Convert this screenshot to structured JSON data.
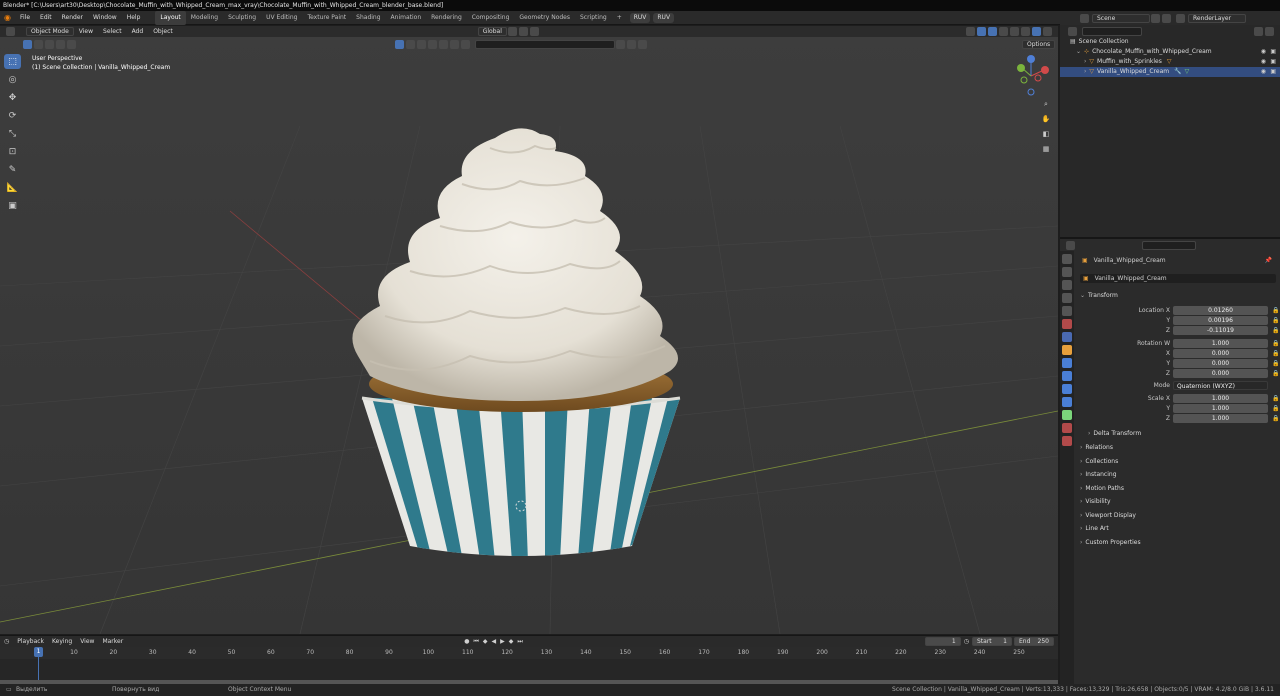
{
  "window": {
    "title": "Blender* [C:\\Users\\art30\\Desktop\\Chocolate_Muffin_with_Whipped_Cream_max_vray\\Chocolate_Muffin_with_Whipped_Cream_blender_base.blend]"
  },
  "menu": [
    "File",
    "Edit",
    "Render",
    "Window",
    "Help"
  ],
  "workspaces": [
    "Layout",
    "Modeling",
    "Sculpting",
    "UV Editing",
    "Texture Paint",
    "Shading",
    "Animation",
    "Rendering",
    "Compositing",
    "Geometry Nodes",
    "Scripting"
  ],
  "workspace_add": "+",
  "topbar_pills": [
    "RUV",
    "RUV"
  ],
  "scene": {
    "label": "Scene",
    "view_layer": "RenderLayer"
  },
  "viewport": {
    "mode": "Object Mode",
    "menus": [
      "View",
      "Select",
      "Add",
      "Object"
    ],
    "transform_orientation": "Global",
    "options_label": "Options",
    "info_line1": "User Perspective",
    "info_line2": "(1) Scene Collection | Vanilla_Whipped_Cream",
    "tools": [
      "cursor-icon",
      "move-icon",
      "rotate-icon",
      "scale-icon",
      "transform-icon",
      "annotate-icon",
      "measure-icon",
      "add-cube-icon"
    ]
  },
  "outliner": {
    "root": "Scene Collection",
    "items": [
      {
        "label": "Chocolate_Muffin_with_Whipped_Cream",
        "depth": 1
      },
      {
        "label": "Muffin_with_Sprinkles",
        "depth": 2
      },
      {
        "label": "Vanilla_Whipped_Cream",
        "depth": 2
      }
    ]
  },
  "properties": {
    "object_name": "Vanilla_Whipped_Cream",
    "data_name": "Vanilla_Whipped_Cream",
    "transform_title": "Transform",
    "location": {
      "label": "Location X",
      "x": "0.01260",
      "y": "0.00196",
      "z": "-0.11019"
    },
    "rotation": {
      "label": "Rotation W",
      "w": "1.000",
      "x": "0.000",
      "y": "0.000",
      "z": "0.000"
    },
    "mode": {
      "label": "Mode",
      "value": "Quaternion (WXYZ)"
    },
    "scale": {
      "label": "Scale X",
      "x": "1.000",
      "y": "1.000",
      "z": "1.000"
    },
    "axis_labels": {
      "y": "Y",
      "z": "Z",
      "x": "X"
    },
    "delta_transform": "Delta Transform",
    "panels": [
      "Relations",
      "Collections",
      "Instancing",
      "Motion Paths",
      "Visibility",
      "Viewport Display",
      "Line Art",
      "Custom Properties"
    ]
  },
  "timeline": {
    "menus": [
      "Playback",
      "Keying",
      "View",
      "Marker"
    ],
    "current_frame": "1",
    "start_label": "Start",
    "start": "1",
    "end_label": "End",
    "end": "250",
    "playhead": "1",
    "ticks": [
      "10",
      "20",
      "30",
      "40",
      "50",
      "60",
      "70",
      "80",
      "90",
      "100",
      "110",
      "120",
      "130",
      "140",
      "150",
      "160",
      "170",
      "180",
      "190",
      "200",
      "210",
      "220",
      "230",
      "240",
      "250"
    ]
  },
  "statusbar": {
    "left1": "Выделить",
    "left2": "Повернуть вид",
    "left3": "Object Context Menu",
    "right": "Scene Collection | Vanilla_Whipped_Cream | Verts:13,333 | Faces:13,329 | Tris:26,658 | Objects:0/5 | VRAM: 4.2/8.0 GiB | 3.6.11"
  }
}
